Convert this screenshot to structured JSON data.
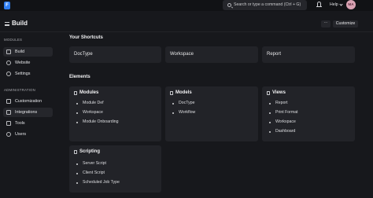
{
  "navbar": {
    "logo": "F",
    "search_placeholder": "Search or type a command (Ctrl + G)",
    "help_label": "Help",
    "avatar_initials": "MA"
  },
  "page": {
    "title": "Build",
    "more_label": "···",
    "customize_label": "Customize"
  },
  "sidebar": {
    "modules_label": "MODULES",
    "modules": [
      "Build",
      "Website",
      "Settings"
    ],
    "administration_label": "ADMINISTRATION",
    "administration": [
      "Customization",
      "Integrations",
      "Tools",
      "Users"
    ]
  },
  "shortcuts": {
    "title": "Your Shortcuts",
    "items": [
      "DocType",
      "Workspace",
      "Report"
    ]
  },
  "elements": {
    "title": "Elements",
    "cards": [
      {
        "title": "Modules",
        "links": [
          "Module Def",
          "Workspace",
          "Module Onboarding"
        ]
      },
      {
        "title": "Models",
        "links": [
          "DocType",
          "Workflow"
        ]
      },
      {
        "title": "Views",
        "links": [
          "Report",
          "Print Format",
          "Workspace",
          "Dashboard"
        ]
      },
      {
        "title": "Scripting",
        "links": [
          "Server Script",
          "Client Script",
          "Scheduled Job Type"
        ]
      }
    ]
  },
  "colors": {
    "background": "#17181c",
    "card": "#222328",
    "accent": "#2f7ef2"
  }
}
